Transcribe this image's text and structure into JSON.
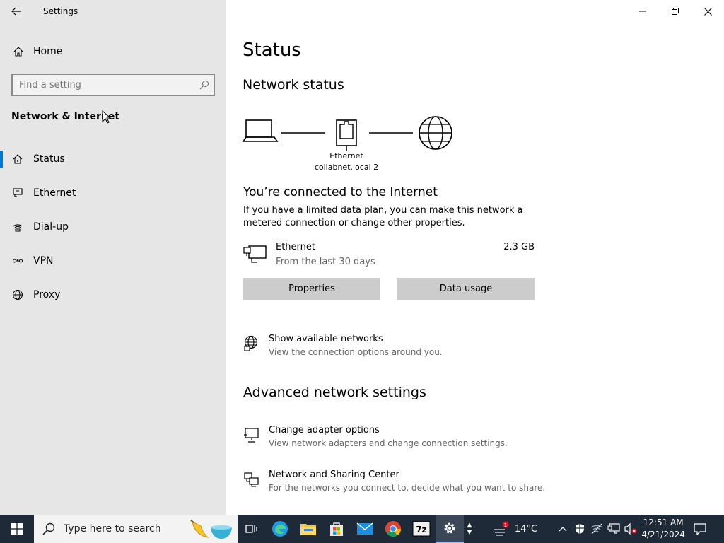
{
  "window": {
    "title": "Settings",
    "controls": [
      "minimize",
      "restore",
      "close"
    ]
  },
  "sidebar": {
    "home_label": "Home",
    "search_placeholder": "Find a setting",
    "section_title": "Network & Internet",
    "items": [
      {
        "label": "Status",
        "icon": "home-wifi-icon",
        "active": true
      },
      {
        "label": "Ethernet",
        "icon": "ethernet-icon",
        "active": false
      },
      {
        "label": "Dial-up",
        "icon": "dialup-icon",
        "active": false
      },
      {
        "label": "VPN",
        "icon": "vpn-icon",
        "active": false
      },
      {
        "label": "Proxy",
        "icon": "globe-icon",
        "active": false
      }
    ]
  },
  "main": {
    "title": "Status",
    "network_status_heading": "Network status",
    "diagram_label_line1": "Ethernet",
    "diagram_label_line2": "collabnet.local 2",
    "connected_heading": "You’re connected to the Internet",
    "connected_desc": "If you have a limited data plan, you can make this network a metered connection or change other properties.",
    "connection": {
      "name": "Ethernet",
      "sub": "From the last 30 days",
      "usage": "2.3 GB"
    },
    "properties_button": "Properties",
    "data_usage_button": "Data usage",
    "show_networks_title": "Show available networks",
    "show_networks_sub": "View the connection options around you.",
    "advanced_heading": "Advanced network settings",
    "adapter_title": "Change adapter options",
    "adapter_sub": "View network adapters and change connection settings.",
    "sharing_title": "Network and Sharing Center",
    "sharing_sub": "For the networks you connect to, decide what you want to share."
  },
  "taskbar": {
    "search_placeholder": "Type here to search",
    "temperature": "14°C",
    "time": "12:51 AM",
    "date": "4/21/2024",
    "weather_badge": "1",
    "zip_label": "7z"
  },
  "colors": {
    "accent": "#0078d4",
    "sidebar_bg": "#e6e6e6",
    "taskbar_bg": "#1f2a38",
    "button_bg": "#cccccc"
  }
}
